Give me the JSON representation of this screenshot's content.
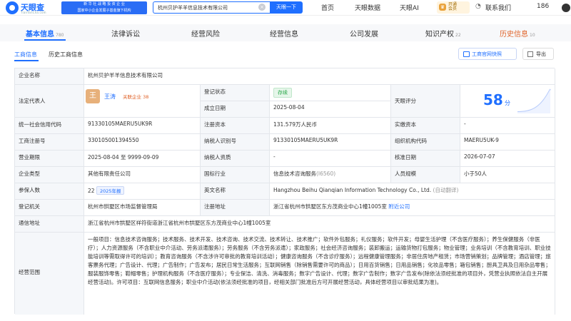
{
  "topbar": {
    "logo_name": "天眼查",
    "logo_url": "TianYanCha.com",
    "slogan_line1": "国家中小企业发展子基金旗下机构",
    "slogan_line2": "新 华 社 战 略 投 资 企 业",
    "search_value": "杭州贝护羊羊信息技术有限公司",
    "search_button": "天眼一下",
    "nav": [
      "首页",
      "天眼数据",
      "天眼AI"
    ],
    "vip_line1": "开通",
    "vip_line2": "会员",
    "contact": "联系我们",
    "phone": "186"
  },
  "tabs": [
    {
      "label": "基本信息",
      "count": "780"
    },
    {
      "label": "法律诉讼",
      "count": ""
    },
    {
      "label": "经营风险",
      "count": ""
    },
    {
      "label": "经营信息",
      "count": ""
    },
    {
      "label": "公司发展",
      "count": ""
    },
    {
      "label": "知识产权",
      "count": "22"
    },
    {
      "label": "历史信息",
      "count": "10"
    }
  ],
  "subtabs": [
    "工商信息",
    "历史工商信息"
  ],
  "actions": {
    "qr": "工商官网快照",
    "export": "导出"
  },
  "info": {
    "company_name_label": "企业名称",
    "company_name": "杭州贝护羊羊信息技术有限公司",
    "legal_rep_label": "法定代表人",
    "legal_rep_avatar": "王",
    "legal_rep_name": "王涛",
    "legal_rep_tag": "关联企业 38",
    "reg_status_label": "登记状态",
    "reg_status": "存续",
    "est_date_label": "成立日期",
    "est_date": "2025-08-04",
    "score_label": "天眼评分",
    "score": "58",
    "score_unit": "分",
    "credit_code_label": "统一社会信用代码",
    "credit_code": "91330105MAERU5UK9R",
    "reg_capital_label": "注册资本",
    "reg_capital": "131.579万人民币",
    "paid_capital_label": "实缴资本",
    "paid_capital": "-",
    "reg_no_label": "工商注册号",
    "reg_no": "330105001394550",
    "taxpayer_id_label": "纳税人识别号",
    "taxpayer_id": "91330105MAERU5UK9R",
    "org_code_label": "组织机构代码",
    "org_code": "MAERU5UK-9",
    "term_label": "营业期限",
    "term": "2025-08-04 至 9999-09-09",
    "taxpayer_qual_label": "纳税人资质",
    "taxpayer_qual": "-",
    "approval_date_label": "核准日期",
    "approval_date": "2026-07-07",
    "type_label": "企业类型",
    "type": "其他有限责任公司",
    "industry_label": "国标行业",
    "industry": "信息技术咨询服务",
    "industry_code": "(I6560)",
    "staff_size_label": "人员规模",
    "staff_size": "小于50人",
    "insured_label": "参保人数",
    "insured": "22",
    "insured_tag": "2025年报",
    "en_name_label": "英文名称",
    "en_name": "Hangzhou Beihu Qianqian Information Technology Co., Ltd.",
    "en_name_note": "(自动翻译)",
    "authority_label": "登记机关",
    "authority": "杭州市拱墅区市场监督管理局",
    "reg_address_label": "注册地址",
    "reg_address": "浙江省杭州市拱墅区东方茂商业中心1幢1005室",
    "nearby_link": "附近公司",
    "comm_address_label": "通信地址",
    "comm_address": "浙江省杭州市拱墅区祥符街道浙江省杭州市拱墅区东方茂商业中心1幢1005室",
    "scope_label": "经营范围",
    "scope": "一般项目：信息技术咨询服务；技术服务、技术开发、技术咨询、技术交流、技术转让、技术推广；软件外包服务；礼仪服务；软件开发；母婴生活护理（不含医疗服务）；养生保健服务（非医疗）；人力资源服务（不含职业中介活动、劳务派遣服务）；劳务服务（不含劳务派遣）；家政服务；社会经济咨询服务；装卸搬运；运输货物打包服务；物业管理；业务培训（不含教育培训、职业技能培训等需取得许可的培训）；教育咨询服务（不含涉许可审批的教育培训活动）；健康咨询服务（不含诊疗服务）；远程健康管理服务；非居住房地产租赁；市场营销策划；品牌管理；酒店管理；旅客票务代理；广告设计、代理；广告制作；广告发布；居民日常生活服务；互联网销售（除销售需要许可的商品）；日用百货销售；日用品销售；化妆品零售；箱包销售；厨具卫具及日用杂品零售；服装服饰零售；鞋帽零售；护理机构服务（不含医疗服务）；专业保洁、清洗、消毒服务；数字广告设计、代理；数字广告制作；数字广告发布(除依法须经批准的项目外，凭营业执照依法自主开展经营活动)。许可项目：互联网信息服务；职业中介活动(依法须经批准的项目，经相关部门批准后方可开展经营活动，具体经营项目以审批结果为准)。"
  },
  "colors": {
    "brand": "#1f6fff",
    "status_green": "#2aa84a",
    "history_orange": "#e0642b"
  }
}
